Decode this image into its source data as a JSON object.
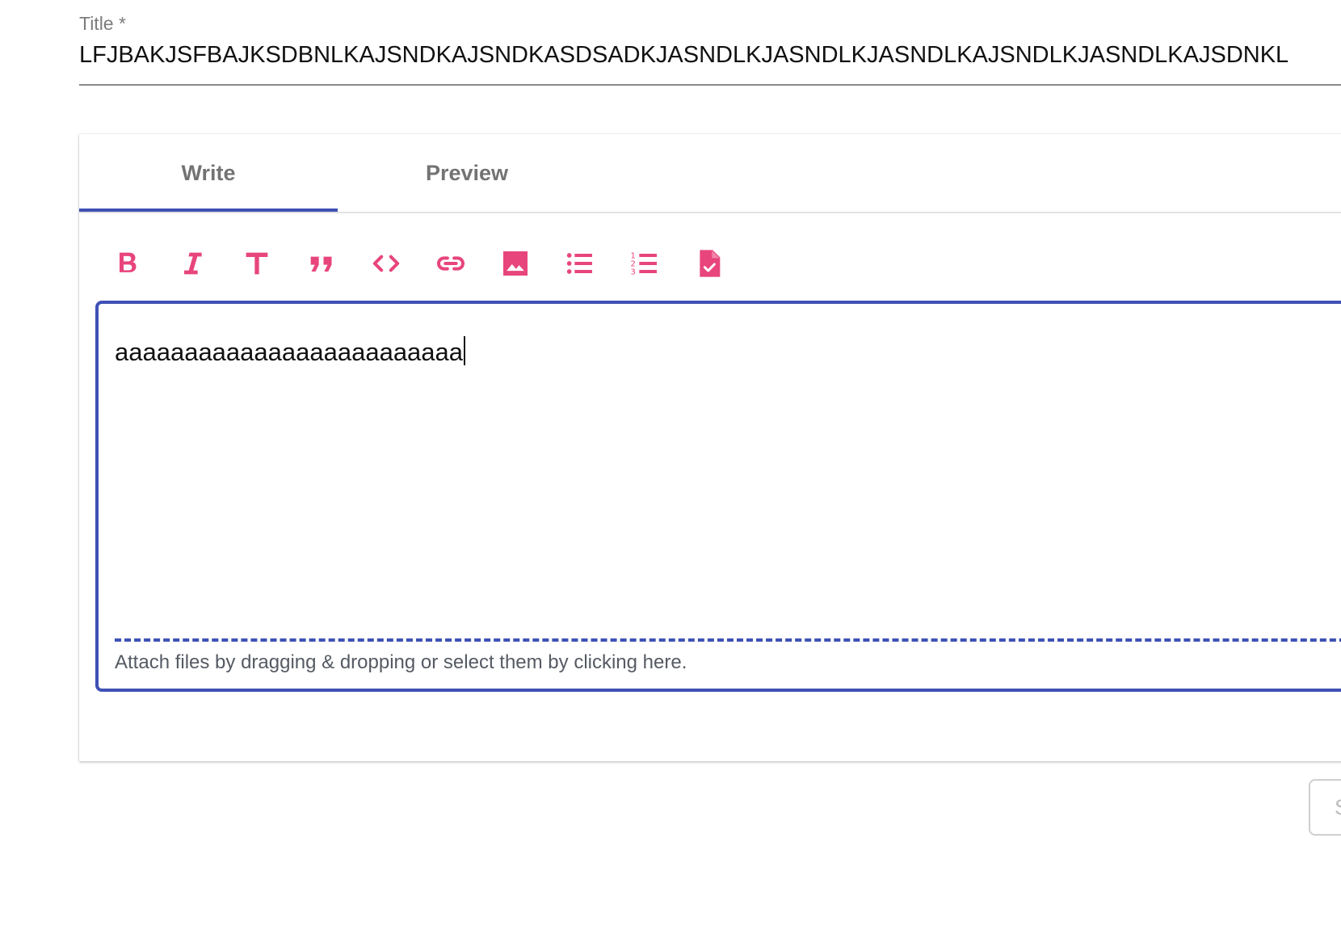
{
  "title_field": {
    "label": "Title *",
    "value": "LFJBAKJSFBAJKSDBNLKAJSNDKAJSNDKASDSADKJASNDLKJASNDLKJASNDLKAJSNDLKJASNDLKAJSDNKL"
  },
  "tabs": [
    {
      "label": "Write",
      "active": true
    },
    {
      "label": "Preview",
      "active": false
    }
  ],
  "toolbar": {
    "icons": [
      "bold-icon",
      "italic-icon",
      "header-icon",
      "quote-icon",
      "code-icon",
      "link-icon",
      "image-icon",
      "bulleted-list-icon",
      "numbered-list-icon",
      "checked-list-icon"
    ]
  },
  "editor": {
    "text": "aaaaaaaaaaaaaaaaaaaaaaaaa",
    "attach_hint": "Attach files by dragging & dropping or select them by clicking here."
  },
  "submit_button": {
    "label": "S"
  },
  "colors": {
    "accent": "#3f51b5",
    "icon": "#e8457c",
    "tab_text": "#737373"
  }
}
